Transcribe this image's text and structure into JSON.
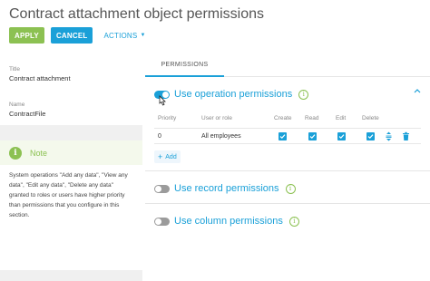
{
  "header": {
    "title": "Contract attachment object permissions"
  },
  "toolbar": {
    "apply_label": "APPLY",
    "cancel_label": "CANCEL",
    "actions_label": "ACTIONS"
  },
  "fields": [
    {
      "label": "Title",
      "value": "Contract attachment"
    },
    {
      "label": "Name",
      "value": "ContractFile"
    }
  ],
  "note": {
    "title": "Note",
    "text": "System operations \"Add any data\", \"View any data\", \"Edit any data\", \"Delete any data\" granted to roles or users have higher priority than permissions that you configure in this section."
  },
  "tabs": [
    {
      "label": "PERMISSIONS",
      "active": true
    }
  ],
  "operation_section": {
    "title": "Use operation permissions",
    "enabled": true,
    "columns": [
      "Priority",
      "User or role",
      "Create",
      "Read",
      "Edit",
      "Delete"
    ],
    "rows": [
      {
        "priority": "0",
        "user": "All employees",
        "create": true,
        "read": true,
        "edit": true,
        "delete": true
      }
    ],
    "add_label": "Add"
  },
  "record_section": {
    "title": "Use record permissions",
    "enabled": false
  },
  "column_section": {
    "title": "Use column permissions",
    "enabled": false
  },
  "colors": {
    "accent": "#1aa0d8",
    "apply": "#8cc152",
    "note": "#8cc152"
  }
}
